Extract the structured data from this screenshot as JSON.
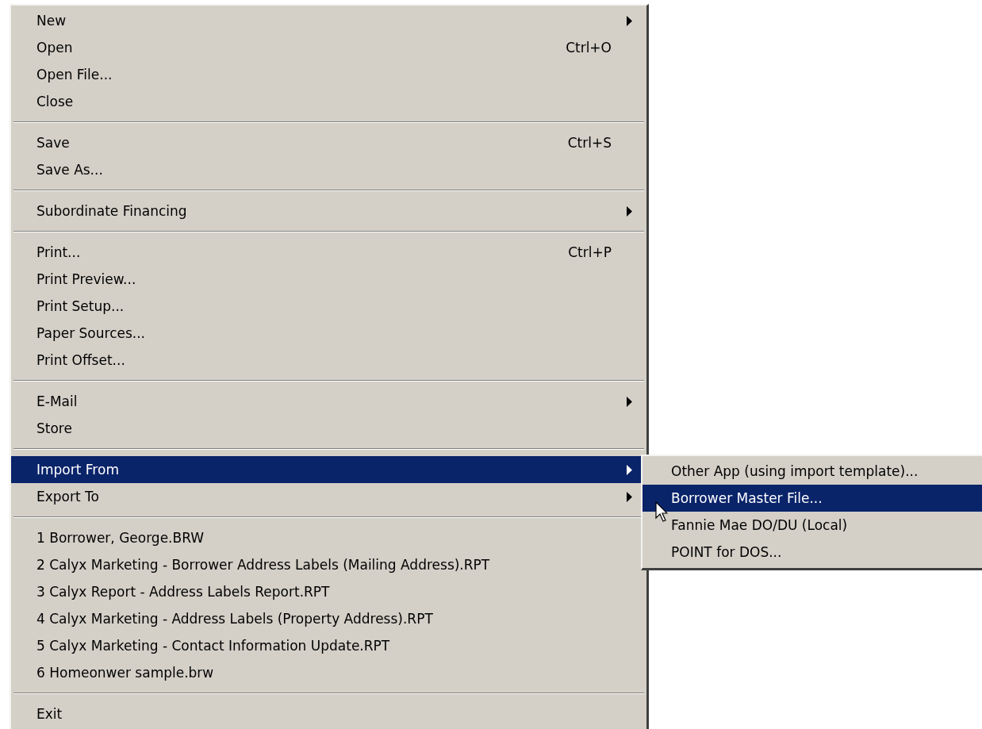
{
  "menu": {
    "groups": [
      [
        {
          "label": "New",
          "kind": "submenu",
          "selected": false
        },
        {
          "label": "Open",
          "shortcut": "Ctrl+O",
          "kind": "command",
          "selected": false
        },
        {
          "label": "Open File...",
          "kind": "command",
          "selected": false
        },
        {
          "label": "Close",
          "kind": "command",
          "selected": false
        }
      ],
      [
        {
          "label": "Save",
          "shortcut": "Ctrl+S",
          "kind": "command",
          "selected": false
        },
        {
          "label": "Save As...",
          "kind": "command",
          "selected": false
        }
      ],
      [
        {
          "label": "Subordinate Financing",
          "kind": "submenu",
          "selected": false
        }
      ],
      [
        {
          "label": "Print...",
          "shortcut": "Ctrl+P",
          "kind": "command",
          "selected": false
        },
        {
          "label": "Print Preview...",
          "kind": "command",
          "selected": false
        },
        {
          "label": "Print Setup...",
          "kind": "command",
          "selected": false
        },
        {
          "label": "Paper Sources...",
          "kind": "command",
          "selected": false
        },
        {
          "label": "Print Offset...",
          "kind": "command",
          "selected": false
        }
      ],
      [
        {
          "label": "E-Mail",
          "kind": "submenu",
          "selected": false
        },
        {
          "label": "Store",
          "kind": "command",
          "selected": false
        }
      ],
      [
        {
          "label": "Import From",
          "kind": "submenu",
          "selected": true
        },
        {
          "label": "Export To",
          "kind": "submenu",
          "selected": false
        }
      ],
      [
        {
          "label": "1 Borrower, George.BRW",
          "kind": "command",
          "selected": false
        },
        {
          "label": "2 Calyx Marketing - Borrower Address Labels (Mailing Address).RPT",
          "kind": "command",
          "selected": false
        },
        {
          "label": "3 Calyx Report - Address Labels Report.RPT",
          "kind": "command",
          "selected": false
        },
        {
          "label": "4 Calyx Marketing - Address Labels (Property Address).RPT",
          "kind": "command",
          "selected": false
        },
        {
          "label": "5 Calyx Marketing - Contact Information Update.RPT",
          "kind": "command",
          "selected": false
        },
        {
          "label": "6 Homeonwer sample.brw",
          "kind": "command",
          "selected": false
        }
      ],
      [
        {
          "label": "Exit",
          "kind": "command",
          "selected": false
        }
      ]
    ]
  },
  "submenu": {
    "items": [
      {
        "label": "Other App (using import template)...",
        "kind": "command",
        "selected": false
      },
      {
        "label": "Borrower Master File...",
        "kind": "command",
        "selected": true
      },
      {
        "label": "Fannie Mae DO/DU (Local)",
        "kind": "command",
        "selected": false
      },
      {
        "label": "POINT for DOS...",
        "kind": "command",
        "selected": false
      }
    ]
  }
}
